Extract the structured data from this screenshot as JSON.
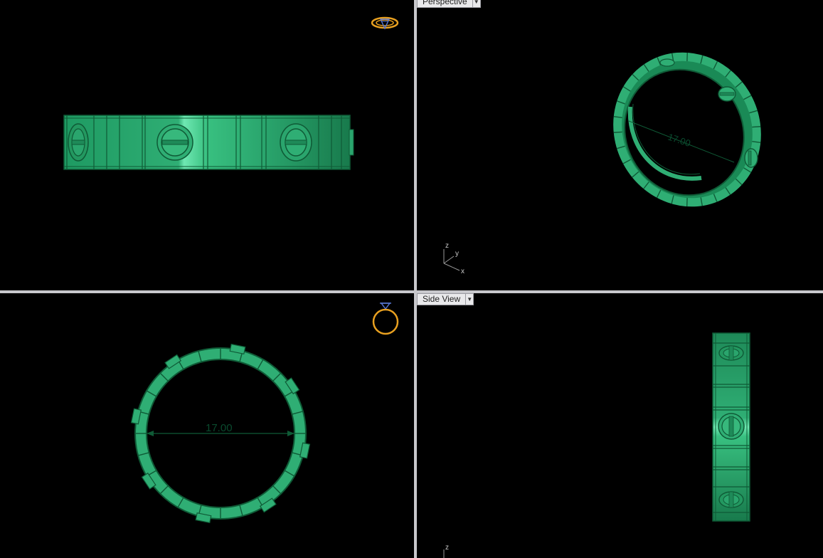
{
  "viewports": {
    "perspective": {
      "label": "Perspective"
    },
    "side": {
      "label": "Side View"
    }
  },
  "dimension": {
    "ring_diameter": "17.00"
  },
  "axes": {
    "perspective": {
      "x": "x",
      "y": "y",
      "z": "z"
    },
    "side": {
      "z": "z"
    }
  },
  "icons": {
    "top_view": "ring-top-icon",
    "front_view": "ring-diamond-icon",
    "dropdown": "chevron-down-icon"
  },
  "colors": {
    "ring_green": "#2fae74",
    "ring_dark": "#0f6f45",
    "ring_light": "#5fe0a6",
    "icon_orange": "#e8a020",
    "icon_blue": "#5a7ad8",
    "divider": "#c8c8cc"
  }
}
